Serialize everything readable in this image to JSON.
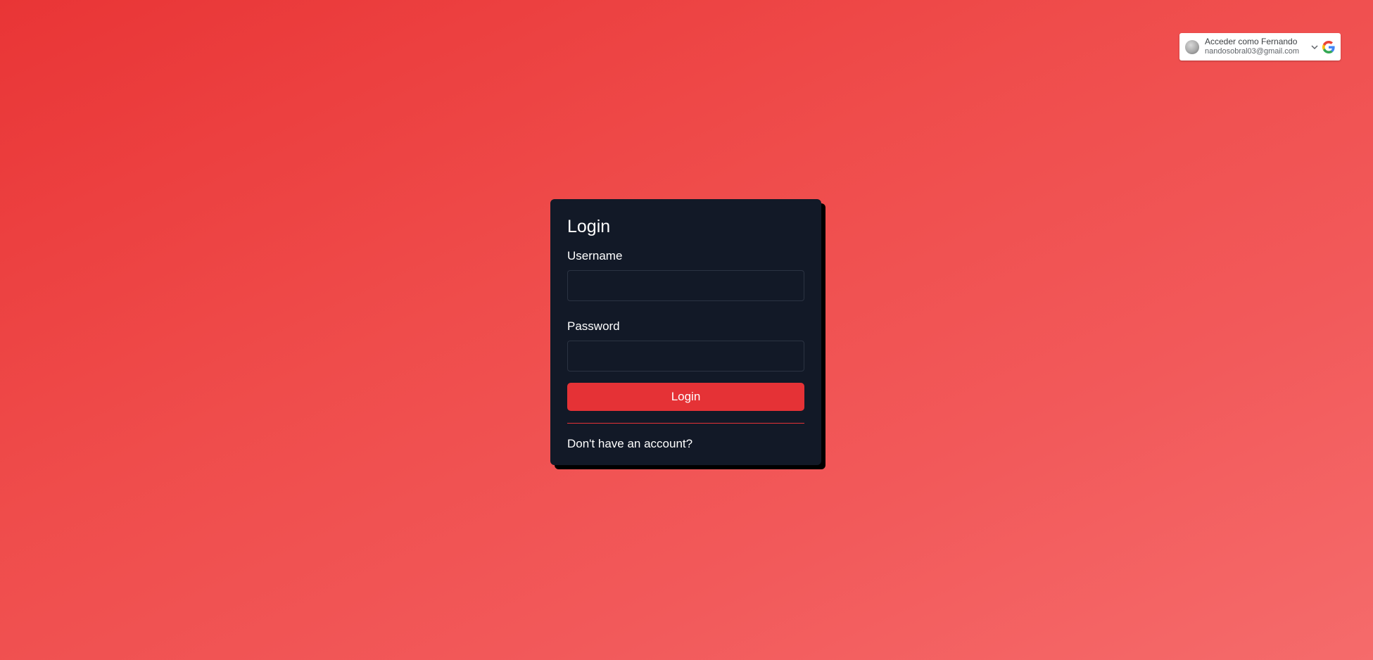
{
  "google_prompt": {
    "title": "Acceder como Fernando",
    "email": "nandosobral03@gmail.com",
    "icons": {
      "avatar": "user-avatar",
      "chevron": "chevron-down-icon",
      "brand": "google-logo-icon"
    }
  },
  "login_form": {
    "title": "Login",
    "username_label": "Username",
    "username_value": "",
    "password_label": "Password",
    "password_value": "",
    "submit_label": "Login",
    "signup_link": "Don't have an account?"
  },
  "colors": {
    "background_start": "#e93536",
    "background_end": "#f56b6b",
    "card": "#121927",
    "accent": "#e53236",
    "text": "#ffffff"
  }
}
